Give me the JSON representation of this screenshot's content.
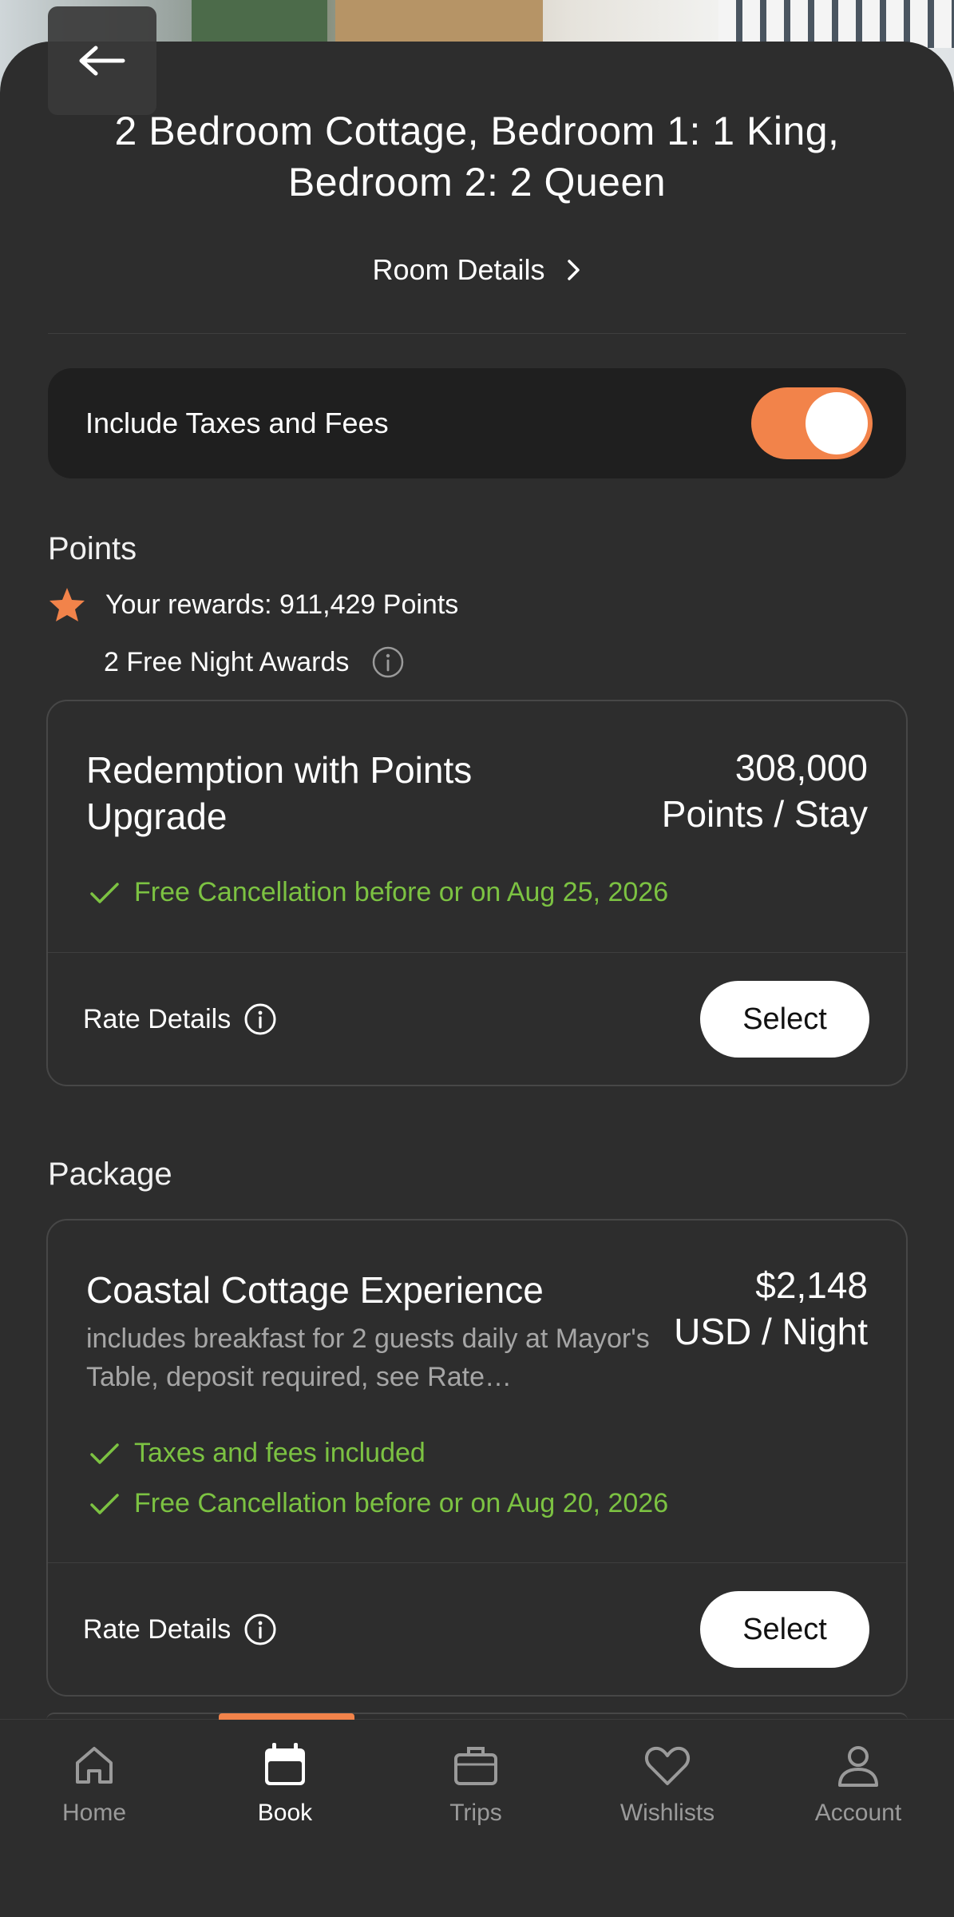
{
  "header": {
    "room_title": "2 Bedroom Cottage, Bedroom 1: 1 King, Bedroom 2: 2 Queen",
    "room_details_label": "Room Details"
  },
  "taxes_toggle": {
    "label": "Include Taxes and Fees",
    "enabled": true,
    "accent_color": "#f2834a"
  },
  "points_section": {
    "title": "Points",
    "rewards_text": "Your rewards: 911,429 Points",
    "free_night_awards": "2 Free Night Awards",
    "rates": [
      {
        "name": "Redemption with Points Upgrade",
        "price_amount": "308,000",
        "price_unit": "Points / Stay",
        "benefits": [
          "Free Cancellation before or on Aug 25, 2026"
        ],
        "rate_details_label": "Rate Details",
        "select_label": "Select"
      }
    ]
  },
  "package_section": {
    "title": "Package",
    "rates": [
      {
        "name": "Coastal Cottage Experience",
        "description": "includes breakfast for 2 guests daily at Mayor's Table, deposit required, see Rate…",
        "price_amount": "$2,148",
        "price_unit": "USD / Night",
        "benefits": [
          "Taxes and fees included",
          "Free Cancellation before or on Aug 20, 2026"
        ],
        "rate_details_label": "Rate Details",
        "select_label": "Select"
      }
    ]
  },
  "bottom_nav": {
    "active": "Book",
    "items": [
      {
        "label": "Home",
        "icon": "home-icon"
      },
      {
        "label": "Book",
        "icon": "calendar-icon"
      },
      {
        "label": "Trips",
        "icon": "suitcase-icon"
      },
      {
        "label": "Wishlists",
        "icon": "heart-icon"
      },
      {
        "label": "Account",
        "icon": "person-icon"
      }
    ]
  },
  "colors": {
    "background": "#2d2d2d",
    "card_dark": "#1f1f1f",
    "accent_orange": "#f2834a",
    "success_green": "#7cc242"
  }
}
